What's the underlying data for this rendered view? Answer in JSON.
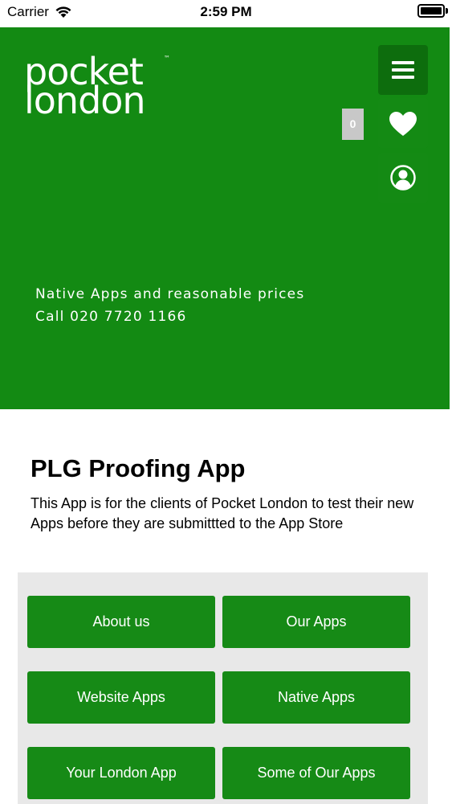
{
  "status_bar": {
    "carrier": "Carrier",
    "time": "2:59 PM"
  },
  "header": {
    "logo_line1": "pocket",
    "logo_line2": "london",
    "logo_tm": "™",
    "favorites_count": "0",
    "tagline_line1": "Native Apps and reasonable prices",
    "tagline_line2": "Call 020 7720 1166",
    "colors": {
      "background": "#138a13",
      "menu_button": "#0d6d0d"
    }
  },
  "intro": {
    "title": "PLG Proofing App",
    "text": "This App is for the clients of Pocket London to test their new Apps before they are submittted to the App Store"
  },
  "buttons": [
    {
      "label": "About us"
    },
    {
      "label": "Our Apps"
    },
    {
      "label": "Website Apps"
    },
    {
      "label": "Native Apps"
    },
    {
      "label": "Your London App"
    },
    {
      "label": "Some of Our Apps"
    }
  ],
  "icons": {
    "menu": "hamburger-icon",
    "favorites": "heart-icon",
    "user": "user-icon",
    "wifi": "wifi-icon"
  }
}
